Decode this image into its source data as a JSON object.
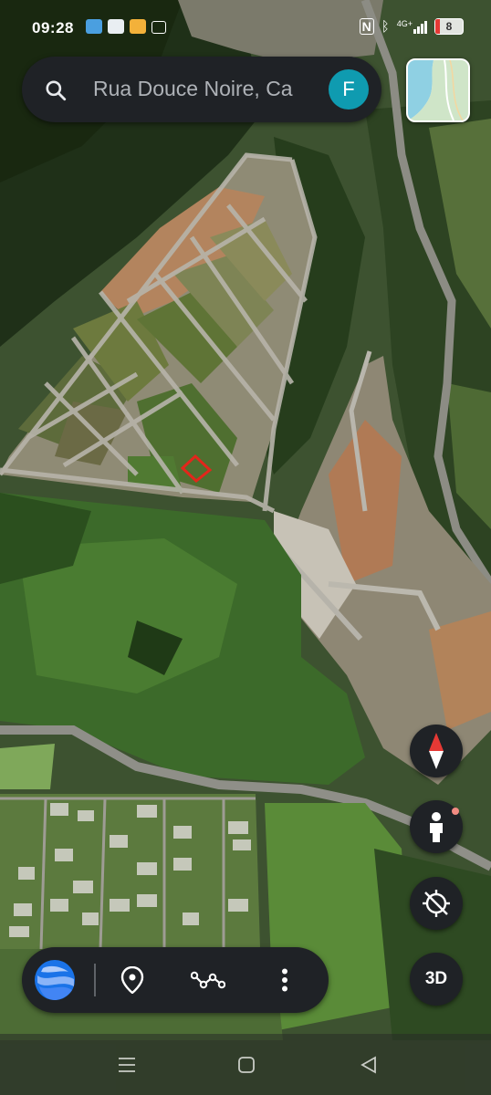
{
  "status_bar": {
    "time": "09:28",
    "battery": "8",
    "network": "4G+",
    "left_icons": [
      "weather-icon",
      "notification-icon",
      "app-icon",
      "calendar-icon"
    ],
    "right_icons": [
      "nfc-icon",
      "bluetooth-icon",
      "signal-icon",
      "battery-icon"
    ]
  },
  "search": {
    "query": "Rua Douce Noire, Ca",
    "avatar_letter": "F",
    "avatar_color": "#0f9bb0"
  },
  "map": {
    "type": "satellite",
    "selected_parcel_color": "#e3261b",
    "layers_button": "layers-icon"
  },
  "controls": {
    "three_d_label": "3D",
    "compass": "compass-icon",
    "street_view": "street-view-person-icon",
    "locate": "my-location-off-icon"
  },
  "toolbar": {
    "items": [
      "google-earth-logo",
      "add-place-icon",
      "measure-distance-icon",
      "more-options-icon"
    ]
  },
  "nav_bar": {
    "buttons": [
      "recents-icon",
      "home-icon",
      "back-icon"
    ]
  },
  "colors": {
    "panel": "#1f2226",
    "compass_red": "#e53935",
    "compass_white": "#ffffff"
  }
}
